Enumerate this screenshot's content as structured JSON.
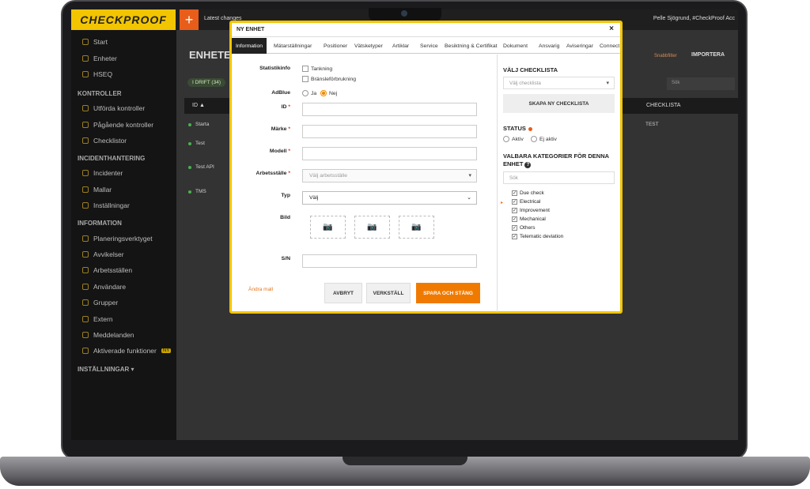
{
  "topbar": {
    "logo": "CHECKPROOF",
    "plus": "+",
    "latest": "Latest changes",
    "user": "Pelle Sjögrund, #CheckProof Acc"
  },
  "sidebar": {
    "items": [
      "Start",
      "Enheter",
      "HSEQ"
    ],
    "kontroller_head": "KONTROLLER",
    "kontroller": [
      "Utförda kontroller",
      "Pågående kontroller",
      "Checklistor"
    ],
    "incident_head": "INCIDENTHANTERING",
    "incident": [
      "Incidenter",
      "Mallar",
      "Inställningar"
    ],
    "info_head": "INFORMATION",
    "info": [
      "Planeringsverktyget",
      "Avvikelser",
      "Arbetsställen",
      "Användare",
      "Grupper",
      "Extern",
      "Meddelanden",
      "Aktiverade funktioner"
    ],
    "badge": "NY",
    "settings_head": "INSTÄLLNINGAR ▾"
  },
  "main": {
    "title": "ENHETE",
    "drift": "I DRIFT (34)",
    "importera": "IMPORTERA",
    "snabb": "Snabbfilter",
    "sok": "Sök",
    "th_id": "ID ▲",
    "th_checklista": "CHECKLISTA",
    "rows": [
      "Starta",
      "Test",
      "Test API",
      "TMS"
    ],
    "row_test": "TEST"
  },
  "modal": {
    "title": "NY ENHET",
    "close": "×",
    "tabs": [
      "Information",
      "Mätarställningar",
      "Positioner",
      "Vätsketyper",
      "Artiklar",
      "Service",
      "Besiktning & Certifikat",
      "Dokument",
      "Ansvarig",
      "Aviseringar",
      "Connect"
    ],
    "statistikinfo": "Statistikinfo",
    "tankning": "Tankning",
    "bransle": "Bränsleförbrukning",
    "adblue": "AdBlue",
    "ja": "Ja",
    "nej": "Nej",
    "id": "ID",
    "marke": "Märke",
    "modell": "Modell",
    "arbetsstalle": "Arbetsställe",
    "arbetsstalle_ph": "Välj arbetsställe",
    "typ": "Typ",
    "typ_val": "Välj",
    "bild": "Bild",
    "sn": "S/N",
    "andra_mall": "Ändra mall",
    "avbryt": "AVBRYT",
    "verkstall": "VERKSTÄLL",
    "spara": "SPARA OCH STÄNG",
    "valj_checklista": "VÄLJ CHECKLISTA",
    "valj_checklista_ph": "Välj checklista",
    "skapa": "SKAPA NY CHECKLISTA",
    "status": "STATUS",
    "aktiv": "Aktiv",
    "ej_aktiv": "Ej aktiv",
    "valbara": "VALBARA KATEGORIER FÖR DENNA ENHET",
    "sok_ph": "Sök",
    "categories": [
      "Due check",
      "Electrical",
      "Improvement",
      "Mechanical",
      "Others",
      "Telematic deviation"
    ]
  }
}
